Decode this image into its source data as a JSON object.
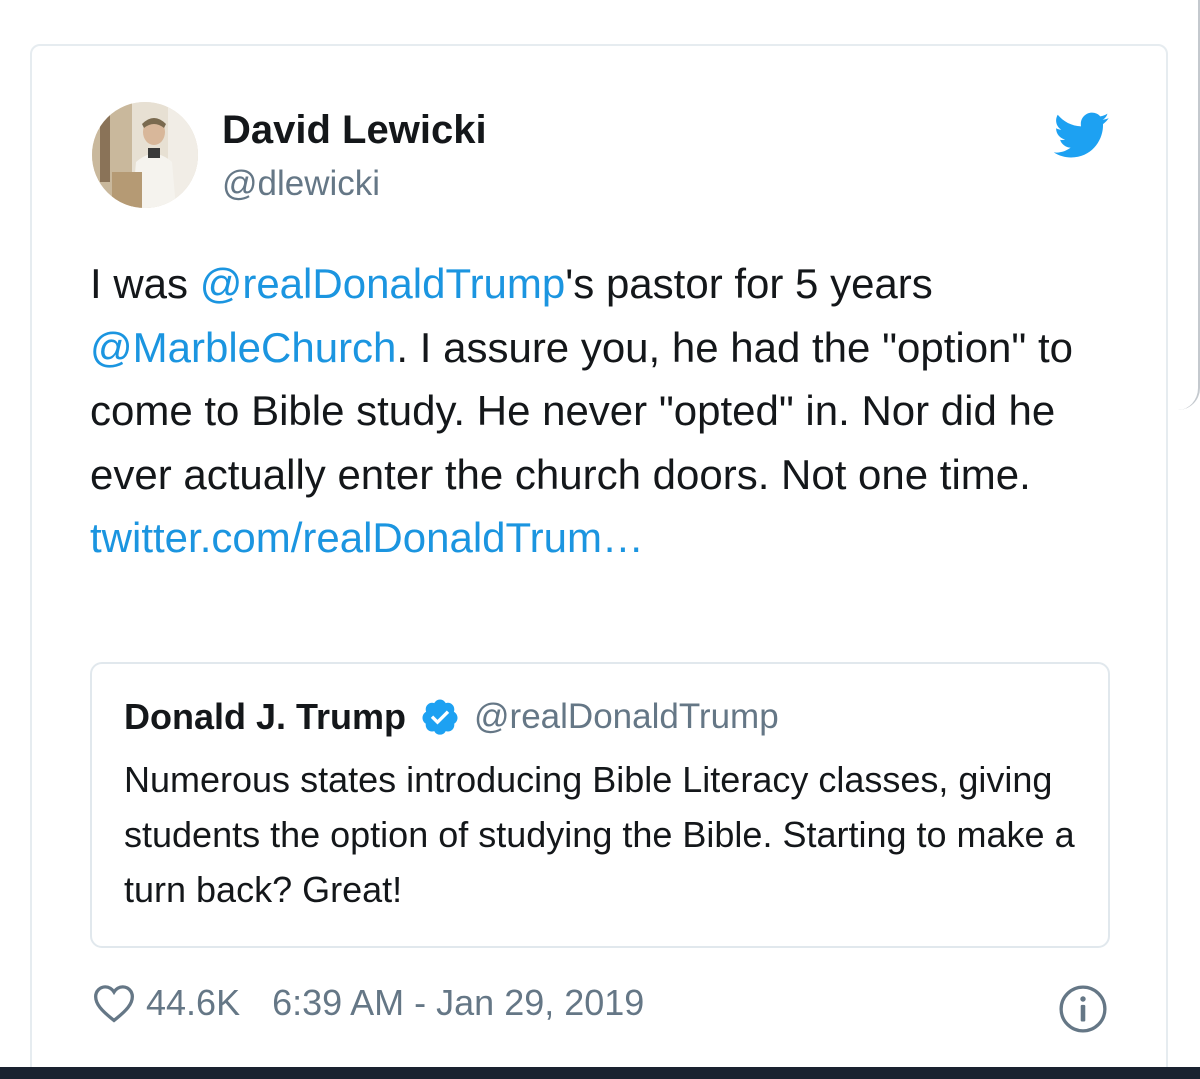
{
  "author": {
    "display_name": "David Lewicki",
    "handle": "@dlewicki"
  },
  "tweet": {
    "segments": [
      {
        "text": "I was ",
        "type": "text"
      },
      {
        "text": "@realDonaldTrump",
        "type": "mention"
      },
      {
        "text": "'s pastor for 5 years ",
        "type": "text"
      },
      {
        "text": "@MarbleChurch",
        "type": "mention"
      },
      {
        "text": ". I assure you, he had the \"option\" to come to Bible study. He never \"opted\" in. Nor did he ever actually enter the church doors. Not one time. ",
        "type": "text"
      },
      {
        "text": "twitter.com/realDonaldTrum…",
        "type": "link"
      }
    ]
  },
  "quote": {
    "display_name": "Donald J. Trump",
    "handle": "@realDonaldTrump",
    "text": "Numerous states introducing Bible Literacy classes, giving students the option of studying the Bible. Starting to make a turn back? Great!"
  },
  "footer": {
    "likes": "44.6K",
    "timestamp": "6:39 AM - Jan 29, 2019"
  },
  "colors": {
    "link": "#1b95e0",
    "twitter_blue": "#1da1f2",
    "text": "#14171a",
    "muted": "#657786"
  },
  "icons": {
    "brand": "twitter-bird-icon",
    "verified": "verified-badge-icon",
    "like": "heart-icon",
    "info": "info-icon"
  }
}
